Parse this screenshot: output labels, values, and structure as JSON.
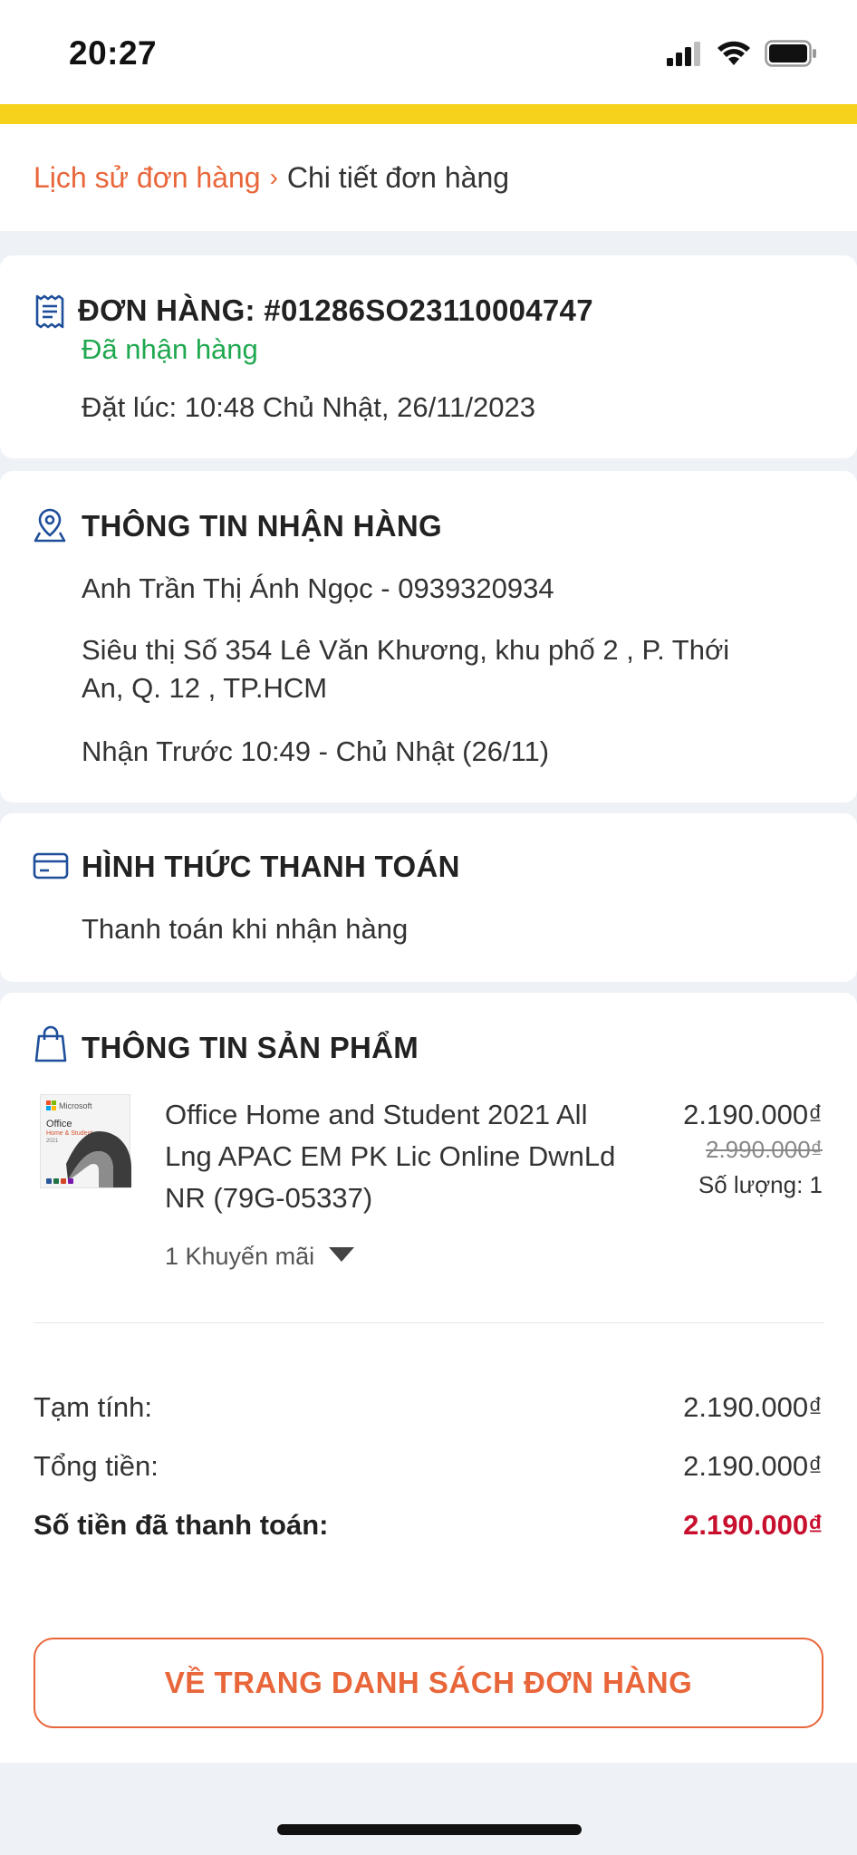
{
  "status_bar": {
    "time": "20:27"
  },
  "breadcrumb": {
    "parent": "Lịch sử đơn hàng",
    "separator": "›",
    "current": "Chi tiết đơn hàng"
  },
  "order": {
    "label": "ĐƠN HÀNG: #01286SO23110004747",
    "status": "Đã nhận hàng",
    "placed_at": "Đặt lúc: 10:48 Chủ Nhật, 26/11/2023",
    "status_color": "#1fa84f"
  },
  "delivery": {
    "title": "THÔNG TIN NHẬN HÀNG",
    "recipient": "Anh Trần Thị Ánh Ngọc - 0939320934",
    "address_line1": "Siêu thị Số 354 Lê Văn Khương, khu phố 2 , P. Thới",
    "address_line2": "An, Q. 12 , TP.HCM",
    "pickup": "Nhận Trước 10:49 - Chủ Nhật (26/11)"
  },
  "payment": {
    "title": "HÌNH THỨC THANH TOÁN",
    "method": "Thanh toán khi nhận hàng"
  },
  "products": {
    "title": "THÔNG TIN SẢN PHẨM",
    "items": [
      {
        "name_line1": "Office Home and Student 2021 All",
        "name_line2": "Lng APAC EM PK Lic Online DwnLd",
        "name_line3": "NR (79G-05337)",
        "price": "2.190.000₫",
        "old_price": "2.990.000₫",
        "quantity": "Số lượng: 1",
        "promo": "1 Khuyến mãi",
        "box_brand": "Microsoft",
        "box_title": "Office",
        "box_subtitle": "Home & Student",
        "box_year": "2021"
      }
    ]
  },
  "summary": {
    "subtotal_label": "Tạm tính:",
    "subtotal_value": "2.190.000₫",
    "total_label": "Tổng tiền:",
    "total_value": "2.190.000₫",
    "paid_label": "Số tiền đã thanh toán:",
    "paid_value": "2.190.000₫",
    "paid_color": "#c8102e"
  },
  "actions": {
    "back_button": "VỀ TRANG DANH SÁCH ĐƠN HÀNG"
  },
  "icons": [
    "signal-icon",
    "wifi-icon",
    "battery-icon",
    "receipt-icon",
    "location-pin-icon",
    "credit-card-icon",
    "shopping-bag-icon",
    "caret-down-icon"
  ],
  "colors": {
    "accent": "#e8663a",
    "brand_yellow": "#f7d21c"
  }
}
